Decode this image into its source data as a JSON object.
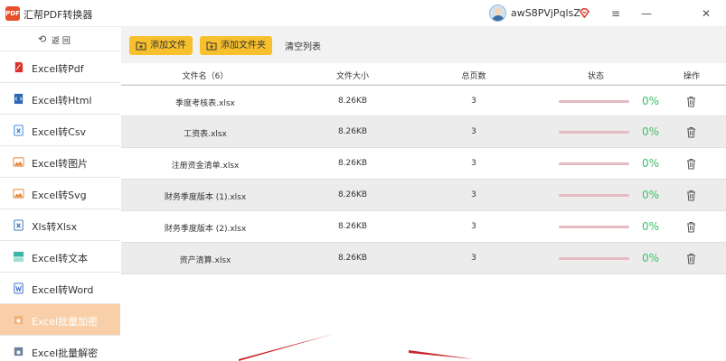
{
  "app": {
    "logo_text": "PDF",
    "title": "汇帮PDF转换器",
    "username": "awS8PVjPqlsZ"
  },
  "window_controls": {
    "menu": "≡",
    "minimize": "—",
    "close": "✕"
  },
  "sidebar": {
    "back_icon": "⟲",
    "back_label": "返 回",
    "items": [
      {
        "label": "Excel转Pdf",
        "icon": "pdf-icon",
        "color": "#d9342b",
        "active": false
      },
      {
        "label": "Excel转Html",
        "icon": "html-icon",
        "color": "#2b66b8",
        "active": false
      },
      {
        "label": "Excel转Csv",
        "icon": "csv-icon",
        "color": "#2e7fd6",
        "active": false
      },
      {
        "label": "Excel转图片",
        "icon": "image-icon",
        "color": "#e5853c",
        "active": false
      },
      {
        "label": "Excel转Svg",
        "icon": "svg-icon",
        "color": "#e58a3a",
        "active": false
      },
      {
        "label": "Xls转Xlsx",
        "icon": "xlsx-icon",
        "color": "#2a6db5",
        "active": false
      },
      {
        "label": "Excel转文本",
        "icon": "text-icon",
        "color": "#3ab6a6",
        "active": false
      },
      {
        "label": "Excel转Word",
        "icon": "word-icon",
        "color": "#2f66c4",
        "active": false
      },
      {
        "label": "Excel批量加密",
        "icon": "encrypt-icon",
        "color": "#f3b27c",
        "active": true
      },
      {
        "label": "Excel批量解密",
        "icon": "decrypt-icon",
        "color": "#6b7f9c",
        "active": false
      }
    ]
  },
  "toolbar": {
    "add_file": "添加文件",
    "add_folder": "添加文件夹",
    "clear_list": "清空列表"
  },
  "table": {
    "headers": {
      "name": "文件名（6）",
      "size": "文件大小",
      "pages": "总页数",
      "status": "状态",
      "action": "操作"
    },
    "rows": [
      {
        "name": "季度考核表.xlsx",
        "size": "8.26KB",
        "pages": "3",
        "progress": 0,
        "percent": "0%"
      },
      {
        "name": "工资表.xlsx",
        "size": "8.26KB",
        "pages": "3",
        "progress": 0,
        "percent": "0%"
      },
      {
        "name": "注册资金清单.xlsx",
        "size": "8.26KB",
        "pages": "3",
        "progress": 0,
        "percent": "0%"
      },
      {
        "name": "财务季度版本 (1).xlsx",
        "size": "8.26KB",
        "pages": "3",
        "progress": 0,
        "percent": "0%"
      },
      {
        "name": "财务季度版本 (2).xlsx",
        "size": "8.26KB",
        "pages": "3",
        "progress": 0,
        "percent": "0%"
      },
      {
        "name": "资产清算.xlsx",
        "size": "8.26KB",
        "pages": "3",
        "progress": 0,
        "percent": "0%"
      }
    ]
  },
  "colors": {
    "accent": "#f9c02e",
    "active_nav": "#f8cfa8",
    "percent_text": "#3dbf6a",
    "progress_track": "#e7b9c3",
    "decor_stroke": "#c9262b"
  }
}
